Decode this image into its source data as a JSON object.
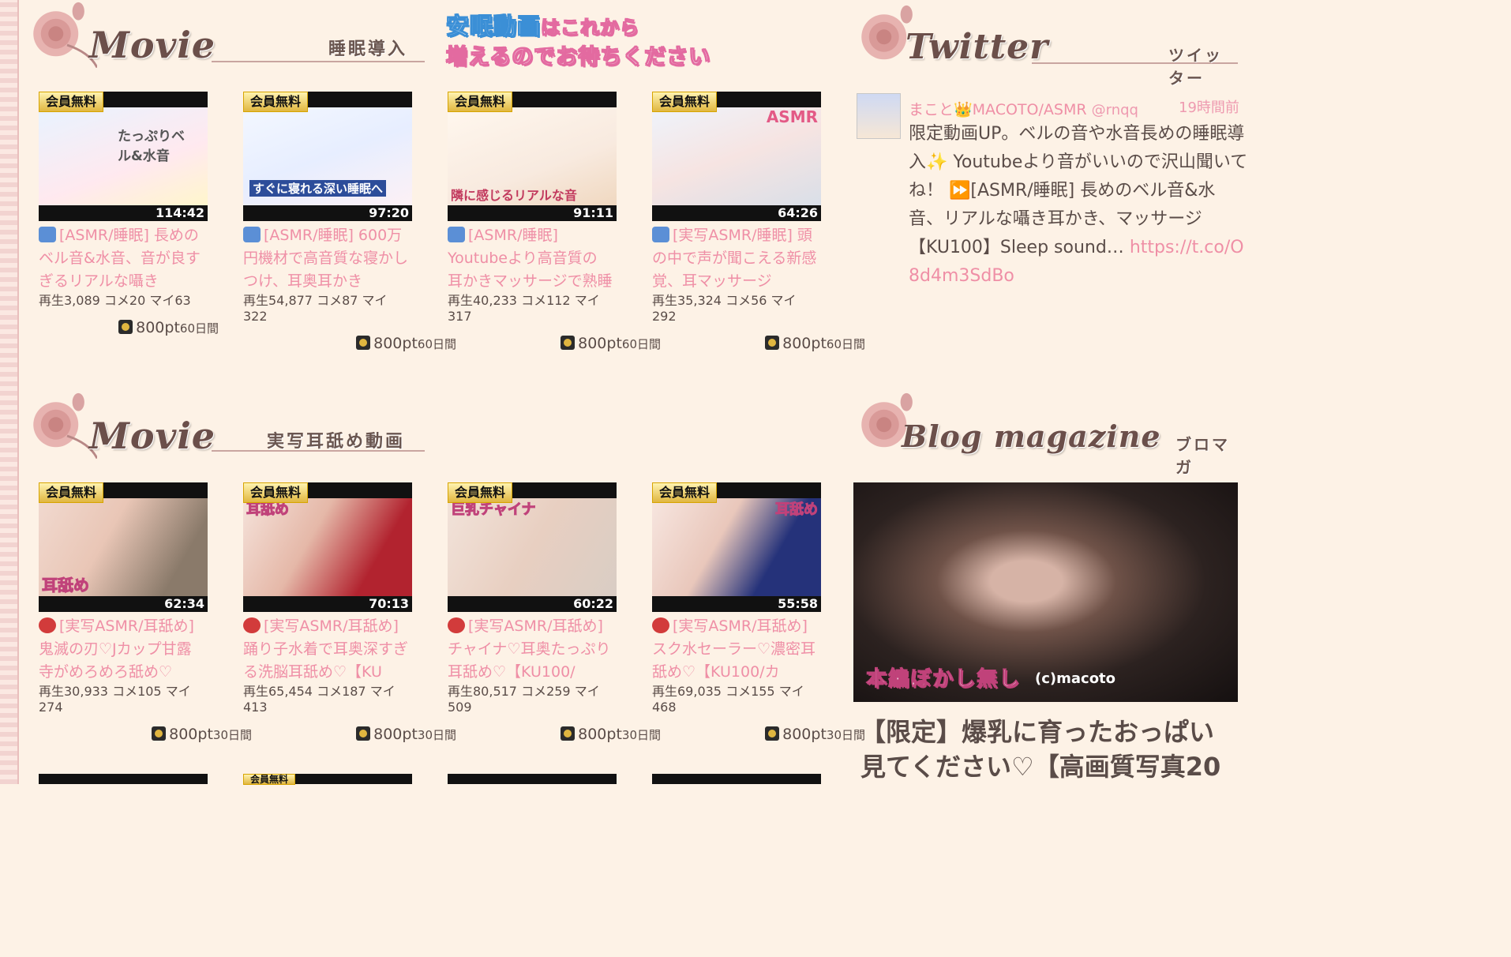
{
  "sections": {
    "movie1": {
      "script": "Movie",
      "subtitle": "睡眠導入"
    },
    "movie2": {
      "script": "Movie",
      "subtitle": "実写耳舐め動画"
    },
    "twitter": {
      "script": "Twitter",
      "subtitle": "ツイッター"
    },
    "blog": {
      "script": "Blog magazine",
      "subtitle": "ブロマガ"
    }
  },
  "announcement": {
    "line1_blue": "安眠動画",
    "line1_rest": "はこれから",
    "line2": "増えるのでお待ちください"
  },
  "row1": [
    {
      "badge": "会員無料",
      "duration": "114:42",
      "thumb_text": "たっぷりベル&水音",
      "title": "[ASMR/睡眠] 長めのベル音&水音、音が良すぎるリアルな囁き",
      "stats": "再生3,089 コメ20 マイ63",
      "price": "800pt",
      "period": "60日間"
    },
    {
      "badge": "会員無料",
      "duration": "97:20",
      "thumb_text": "すぐに寝れる深い睡眠へ",
      "title": "[ASMR/睡眠] 600万円機材で高音質な寝かしつけ、耳奥耳かき",
      "stats": "再生54,877 コメ87 マイ322",
      "price": "800pt",
      "period": "60日間"
    },
    {
      "badge": "会員無料",
      "duration": "91:11",
      "thumb_text": "隣に感じるリアルな音",
      "title": "[ASMR/睡眠] Youtubeより高音質の 耳かきマッサージで熟睡で",
      "stats": "再生40,233 コメ112 マイ317",
      "price": "800pt",
      "period": "60日間"
    },
    {
      "badge": "会員無料",
      "duration": "64:26",
      "thumb_text": "ASMR",
      "title": "[実写ASMR/睡眠] 頭の中で声が聞こえる新感覚、耳マッサージ",
      "stats": "再生35,324 コメ56 マイ292",
      "price": "800pt",
      "period": "60日間"
    }
  ],
  "row2": [
    {
      "badge": "会員無料",
      "duration": "62:34",
      "thumb_text": "耳舐め",
      "title": "[実写ASMR/耳舐め] 鬼滅の刃♡Jカップ甘露寺がめろめろ舐め♡",
      "stats": "再生30,933 コメ105 マイ274",
      "price": "800pt",
      "period": "30日間"
    },
    {
      "badge": "会員無料",
      "duration": "70:13",
      "thumb_text": "耳舐め",
      "title": "[実写ASMR/耳舐め] 踊り子水着で耳奥深すぎる洗脳耳舐め♡【KU",
      "stats": "再生65,454 コメ187 マイ413",
      "price": "800pt",
      "period": "30日間"
    },
    {
      "badge": "会員無料",
      "duration": "60:22",
      "thumb_text": "巨乳チャイナ",
      "title": "[実写ASMR/耳舐め] チャイナ♡耳奥たっぷり耳舐め♡【KU100/",
      "stats": "再生80,517 コメ259 マイ509",
      "price": "800pt",
      "period": "30日間"
    },
    {
      "badge": "会員無料",
      "duration": "55:58",
      "thumb_text": "耳舐め",
      "title": "[実写ASMR/耳舐め] スク水セーラー♡濃密耳舐め♡【KU100/カ",
      "stats": "再生69,035 コメ155 マイ468",
      "price": "800pt",
      "period": "30日間"
    }
  ],
  "twitter": {
    "name": "まこと👑MACOTO/ASMR",
    "handle": "@rnqq",
    "time": "19時間前",
    "body": "限定動画UP。ベルの音や水音長めの睡眠導入✨ Youtubeより音がいいので沢山聞いてね！ ⏩[ASMR/睡眠] 長めのベル音&水音、リアルな囁き耳かき、マッサージ【KU100】Sleep sound… ",
    "link": "https://t.co/O8d4m3SdBo"
  },
  "blog": {
    "caption": "本編ぼかし無し",
    "copyright": "(c)macoto",
    "title": "【限定】爆乳に育ったおっぱい見てください♡【高画質写真20"
  },
  "bottom_badge": "会員無料",
  "colors": {
    "background": "#fdf2e6",
    "pink": "#ef8fa6",
    "text": "#5a4c48"
  }
}
